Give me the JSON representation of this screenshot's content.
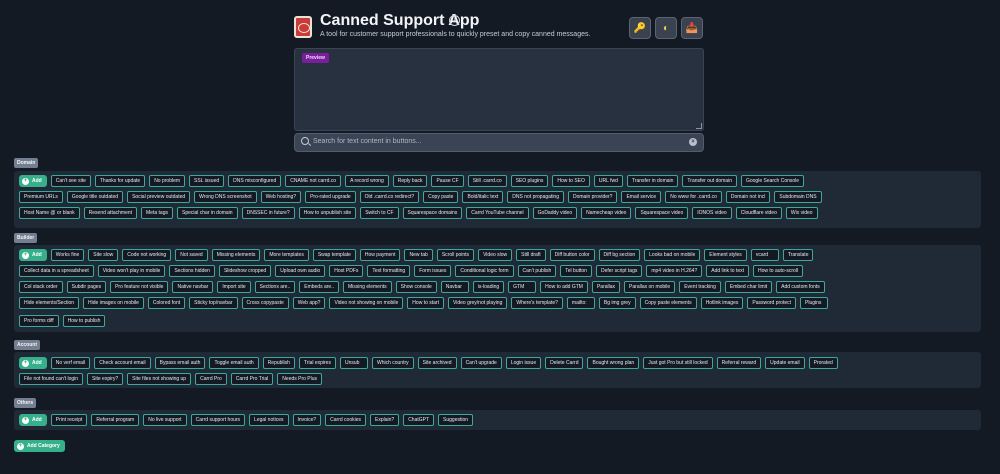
{
  "header": {
    "title": "Canned Support App",
    "subtitle": "A tool for customer support professionals to quickly preset and copy canned messages.",
    "buttons": [
      {
        "icon": "key-icon",
        "glyph": "🔑"
      },
      {
        "icon": "half-moon-icon",
        "glyph": "◐"
      },
      {
        "icon": "inbox-tray-icon",
        "glyph": "📥"
      }
    ]
  },
  "preview": {
    "badge": "Preview"
  },
  "search": {
    "placeholder": "Search for text content in buttons..."
  },
  "add_button": "Add",
  "add_category": "Add Category",
  "categories": [
    {
      "name": "Domain",
      "rows": [
        [
          "Can't see site",
          "Thanks for update",
          "No problem",
          "SSL issued",
          "DNS misconfigured",
          "CNAME not carrd.co",
          "A record wrong",
          "Reply back",
          "Pause CF",
          "Still .carrd.co",
          "SEO plugins",
          "How to SEO",
          "URL fwd",
          "Transfer in domain",
          "Transfer out domain",
          "Google Search Console"
        ],
        [
          "Premium URLs",
          "Google title outdated",
          "Social preview outdated",
          "Wrong DNS screenshot",
          "Web hosting?",
          "Pro-rated upgrade",
          "Old .carrd.co redirect?",
          "Copy paste",
          "Bold/italic text",
          "DNS not propagating",
          "Domain provider?",
          "Email service",
          "No www for .carrd.co",
          "Domain not incl",
          "Subdomain DNS"
        ],
        [
          "Host Name @ or blank",
          "Resend attachment",
          "Meta tags",
          "Special char in domain",
          "DNSSEC in future?",
          "How to unpublish site",
          "Switch to CF",
          "Squarespace domains",
          "Carrd YouTube channel",
          "GoDaddy video",
          "Namecheap video",
          "Squarespace video",
          "IONOS video",
          "Cloudflare video",
          "Wix video"
        ]
      ]
    },
    {
      "name": "Builder",
      "rows": [
        [
          "Works fine",
          "Site slow",
          "Code not working",
          "Not saved",
          "Missing elements",
          "More templates",
          "Swap template",
          "How payment",
          "New tab",
          "Scroll points",
          "Video slow",
          "Still draft",
          "Diff button color",
          "Diff bg section",
          "Looks bad on mobile",
          "Element styles",
          "vcard",
          "Translate"
        ],
        [
          "Collect data in a spreadsheet",
          "Video won't play in mobile",
          "Sections hidden",
          "Slideshow cropped",
          "Upload own audio",
          "Host PDFs",
          "Text formatting",
          "Form issues",
          "Conditional logic form",
          "Can't publish",
          "Tel button",
          "Defer script tags",
          "mp4 video in H.264?",
          "Add link to text",
          "How to auto-scroll"
        ],
        [
          "Col stack order",
          "Subdir pages",
          "Pro feature not visible",
          "Native navbar",
          "Import site",
          "Sections are..",
          "Embeds are..",
          "Missing elements",
          "Show console",
          "Navbar",
          "is-loading",
          "GTM",
          "How to add GTM",
          "Parallax",
          "Parallax on mobile",
          "Event tracking",
          "Embed char limit",
          "Add custom fonts"
        ],
        [
          "Hide elements/Section",
          "Hide images on mobile",
          "Colored font",
          "Sticky top/navbar",
          "Cross copypaste",
          "Web app?",
          "Video not showing on mobile",
          "How to start",
          "Video grey/not playing",
          "Where's template?",
          "mailto:",
          "Bg img grey",
          "Copy paste elements",
          "Hotlink images",
          "Password protect",
          "Plugins"
        ],
        [
          "Pro forms diff",
          "How to publish"
        ]
      ]
    },
    {
      "name": "Account",
      "rows": [
        [
          "No verf email",
          "Check account email",
          "Bypass email auth",
          "Toggle email auth",
          "Republish",
          "Trial expires",
          "Unsub",
          "Which country",
          "Site archived",
          "Can't upgrade",
          "Login issue",
          "Delete Carrd",
          "Bought wrong plan",
          "Just got Pro but still locked",
          "Referral reward",
          "Update email",
          "Prorated"
        ],
        [
          "File not found can't login",
          "Site expiry?",
          "Site files not showing up",
          "Carrd Pro",
          "Carrd Pro Trial",
          "Needs Pro Plus"
        ]
      ]
    },
    {
      "name": "Others",
      "rows": [
        [
          "Print receipt",
          "Referral program",
          "No live support",
          "Carrd support hours",
          "Legal notices",
          "Invoice?",
          "Carrd cookies",
          "Explain?",
          "ChatGPT",
          "Suggestion"
        ]
      ]
    }
  ]
}
